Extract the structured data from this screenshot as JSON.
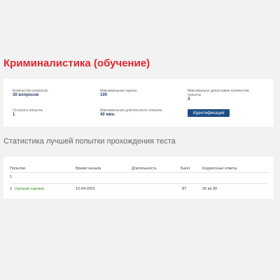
{
  "page": {
    "title": "Криминалистика (обучение)"
  },
  "info": {
    "questions_count_label": "Количество вопросов",
    "questions_count_value": "30 вопросов",
    "max_score_label": "Максимальная оценка",
    "max_score_value": "100",
    "max_attempts_label": "Максимально допустимое количество попыток",
    "max_attempts_value": "3",
    "attempts_left_label": "Осталось попыток",
    "attempts_left_value": "1",
    "max_duration_label": "Максимальная длительность попытки",
    "max_duration_value": "40 мин.",
    "identify_button": "Идентификация"
  },
  "stats": {
    "section_title": "Статистика лучшей попытки прохождения теста",
    "columns": [
      "Попытки",
      "Время начала",
      "Длительность",
      "Балл",
      "Корректные ответы"
    ],
    "rows": [
      {
        "attempt": "1",
        "note": "",
        "start": "",
        "duration": "",
        "score": "",
        "correct": ""
      },
      {
        "attempt": "2",
        "note": "(лучшая оценка)",
        "start": "12-04-2021",
        "duration": "",
        "score": "87",
        "correct": "26 из 30"
      }
    ]
  },
  "colors": {
    "title": "#e0262f",
    "button": "#1f4e86",
    "best_note": "#2e8b22"
  }
}
